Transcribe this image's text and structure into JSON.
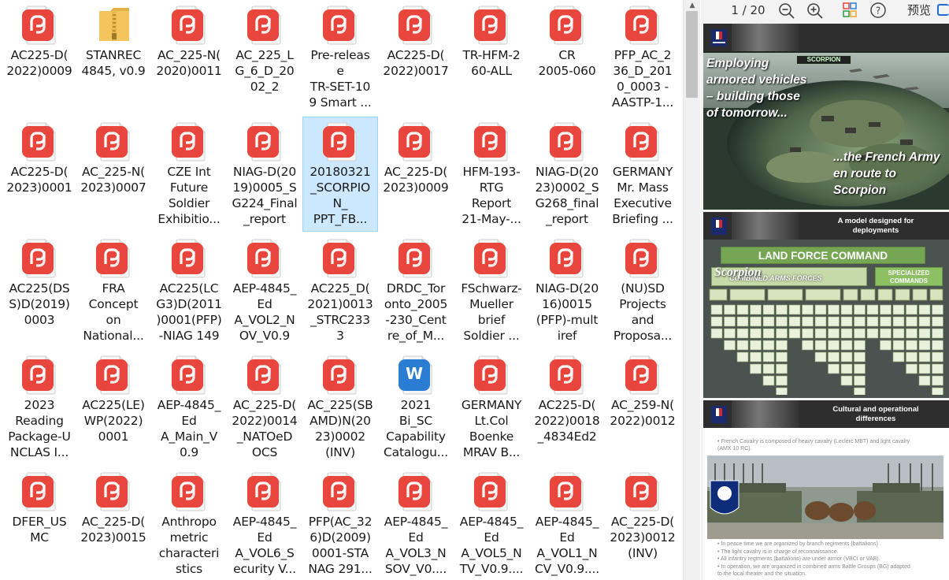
{
  "files": [
    {
      "name": "AC225-D(\n2022)0009",
      "type": "pdf"
    },
    {
      "name": "STANREC\n4845, v0.9",
      "type": "folder"
    },
    {
      "name": "AC_225-N(\n2020)0011",
      "type": "pdf"
    },
    {
      "name": "AC_225_L\nG_6_D_20\n02_2",
      "type": "pdf"
    },
    {
      "name": "Pre-releas\ne\nTR-SET-10\n9 Smart ...",
      "type": "pdf"
    },
    {
      "name": "AC225-D(\n2022)0017",
      "type": "pdf"
    },
    {
      "name": "TR-HFM-2\n60-ALL",
      "type": "pdf"
    },
    {
      "name": "CR\n2005-060",
      "type": "pdf"
    },
    {
      "name": "PFP_AC_2\n36_D_201\n0_0003 -\nAASTP-1...",
      "type": "pdf"
    },
    {
      "name": "AC225-D(\n2023)0001",
      "type": "pdf"
    },
    {
      "name": "AC_225-N(\n2023)0007",
      "type": "pdf"
    },
    {
      "name": "CZE Int\nFuture\nSoldier\nExhibitio...",
      "type": "pdf"
    },
    {
      "name": "NIAG-D(20\n19)0005_S\nG224_Final\n_report",
      "type": "pdf"
    },
    {
      "name": "20180321\n_SCORPIO\nN_\nPPT_FB...",
      "type": "pdf",
      "selected": true
    },
    {
      "name": "AC_225-D(\n2023)0009",
      "type": "pdf"
    },
    {
      "name": "HFM-193-\nRTG\nReport\n21-May-...",
      "type": "pdf"
    },
    {
      "name": "NIAG-D(20\n23)0002_S\nG268_final\n_report",
      "type": "pdf"
    },
    {
      "name": "GERMANY\nMr. Mass\nExecutive\nBriefing ...",
      "type": "pdf"
    },
    {
      "name": "AC225(DS\nS)D(2019)\n0003",
      "type": "pdf"
    },
    {
      "name": "FRA\nConcept\non\nNational...",
      "type": "pdf"
    },
    {
      "name": "AC225(LC\nG3)D(2011\n)0001(PFP)\n-NIAG 149",
      "type": "pdf"
    },
    {
      "name": "AEP-4845_\nEd\nA_VOL2_N\nOV_V0.9",
      "type": "pdf"
    },
    {
      "name": "AC225_D(\n2021)0013\n_STRC233\n3",
      "type": "pdf"
    },
    {
      "name": "DRDC_Tor\nonto_2005\n-230_Cent\nre_of_M...",
      "type": "pdf"
    },
    {
      "name": "FSchwarz-\nMueller\nbrief\nSoldier ...",
      "type": "pdf"
    },
    {
      "name": "NIAG-D(20\n16)0015\n(PFP)-mult\niref",
      "type": "pdf"
    },
    {
      "name": "(NU)SD\nProjects\nand\nProposa...",
      "type": "pdf"
    },
    {
      "name": "2023\nReading\nPackage-U\nNCLAS I...",
      "type": "pdf"
    },
    {
      "name": "AC225(LE)\nWP(2022)\n0001",
      "type": "pdf"
    },
    {
      "name": "AEP-4845_\nEd\nA_Main_V\n0.9",
      "type": "pdf"
    },
    {
      "name": "AC_225-D(\n2022)0014\n_NATOeD\nOCS",
      "type": "pdf"
    },
    {
      "name": "AC_225(SB\nAMD)N(20\n23)0002\n(INV)",
      "type": "pdf"
    },
    {
      "name": "2021\nBi_SC\nCapability\nCatalogu...",
      "type": "word"
    },
    {
      "name": "GERMANY\nLt.Col\nBoenke\nMRAV B...",
      "type": "pdf"
    },
    {
      "name": "AC225-D(\n2022)0018\n_4834Ed2",
      "type": "pdf"
    },
    {
      "name": "AC_259-N(\n2022)0012",
      "type": "pdf"
    },
    {
      "name": "DFER_US\nMC",
      "type": "pdf"
    },
    {
      "name": "AC_225-D(\n2023)0015",
      "type": "pdf"
    },
    {
      "name": "Anthropo\nmetric\ncharacteri\nstics",
      "type": "pdf"
    },
    {
      "name": "AEP-4845_\nEd\nA_VOL6_S\necurity V...",
      "type": "pdf"
    },
    {
      "name": "PFP(AC_32\n6)D(2009)\n0001-STA\nNAG 291...",
      "type": "pdf"
    },
    {
      "name": "AEP-4845_\nEd\nA_VOL3_N\nSOV_V0....",
      "type": "pdf"
    },
    {
      "name": "AEP-4845_\nEd\nA_VOL5_N\nTV_V0.9....",
      "type": "pdf"
    },
    {
      "name": "AEP-4845_\nEd\nA_VOL1_N\nCV_V0.9....",
      "type": "pdf"
    },
    {
      "name": "AC_225-D(\n2023)0012\n(INV)",
      "type": "pdf"
    }
  ],
  "preview": {
    "page_indicator": "1 / 20",
    "label": "预览",
    "icons": [
      "zoom-out-icon",
      "zoom-in-icon",
      "grid-view-icon",
      "help-icon"
    ],
    "slides": [
      {
        "left_text": "Employing\narmored vehicles\n– building those\nof tomorrow...",
        "right_text": "...the French Army\nen route to\nScorpion",
        "logo_text": "SCORPION"
      },
      {
        "header_title": "A model designed for\ndeployments",
        "banner": "LAND FORCE COMMAND",
        "logo_script": "Scorpion",
        "subbanner": "COMBINED ARMS FORCES",
        "special": "SPECIALIZED\nCOMMANDS"
      },
      {
        "header_title": "Cultural and operational\ndifferences",
        "bullets_top": [
          "French Cavalry is composed of heavy cavalry (Leclerc MBT) and light cavalry",
          "(AMX 10 RC)."
        ],
        "bullets_bottom": [
          "In peace time we are organized by branch regiments (battalions) .",
          "The light cavalry is in charge of reconnaissance.",
          "All infantry regiments (battalions) are under armor (VBCI or VAB).",
          "In operation, we are organized in combined arms Battle Groups (BG) adapted",
          "to the local theater and the situation."
        ]
      }
    ]
  },
  "colors": {
    "pdf_red": "#e8453c",
    "folder_yellow": "#f4c55c",
    "word_blue": "#2b7cd3",
    "selection_bg": "#cce8ff",
    "selection_border": "#99d1ff"
  }
}
